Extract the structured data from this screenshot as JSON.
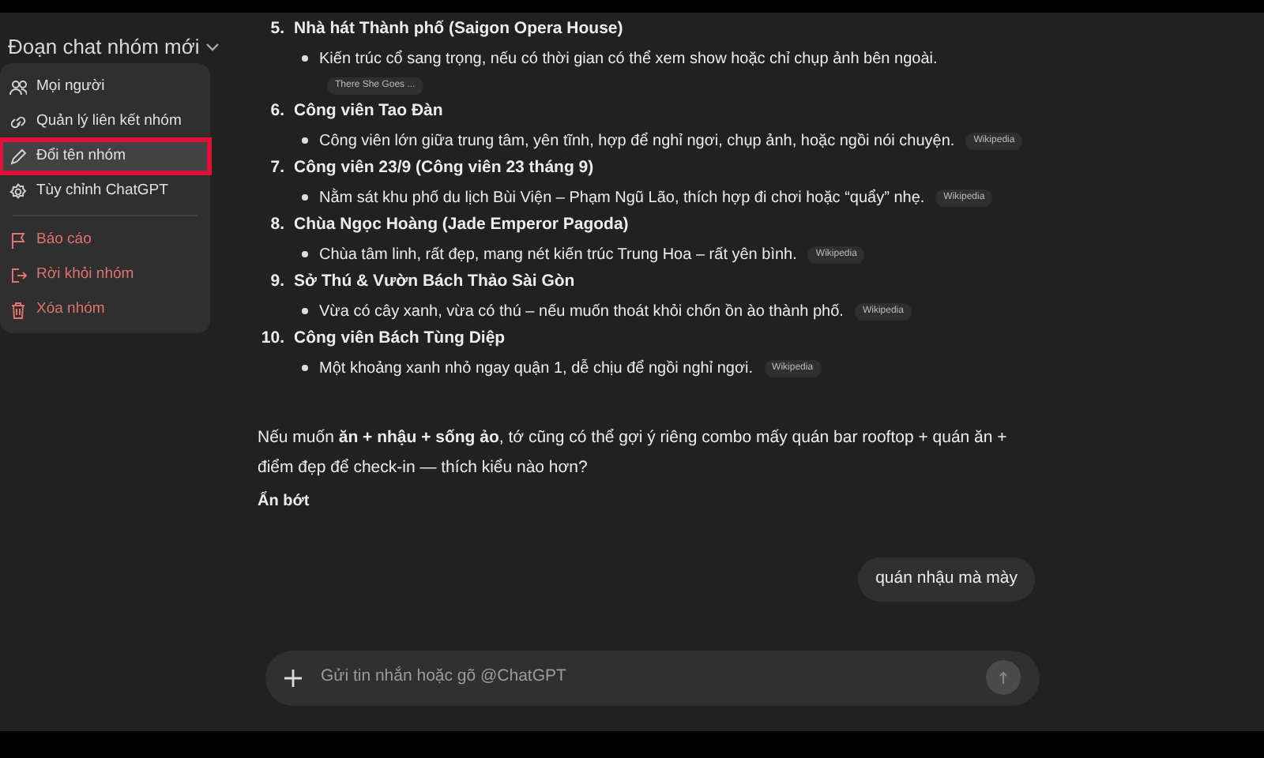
{
  "header": {
    "title": "Đoạn chat nhóm mới"
  },
  "menu": {
    "items": [
      {
        "label": "Mọi người",
        "kind": "people",
        "danger": false,
        "selected": false
      },
      {
        "label": "Quản lý liên kết nhóm",
        "kind": "link",
        "danger": false,
        "selected": false
      },
      {
        "label": "Đổi tên nhóm",
        "kind": "pencil",
        "danger": false,
        "selected": true
      },
      {
        "label": "Tùy chỉnh ChatGPT",
        "kind": "gear",
        "danger": false,
        "selected": false
      },
      {
        "label": "Báo cáo",
        "kind": "flag",
        "danger": true,
        "selected": false
      },
      {
        "label": "Rời khỏi nhóm",
        "kind": "exit",
        "danger": true,
        "selected": false
      },
      {
        "label": "Xóa nhóm",
        "kind": "trash",
        "danger": true,
        "selected": false
      }
    ]
  },
  "list": [
    {
      "number": "5.",
      "title": "Nhà hát Thành phố (Saigon Opera House)",
      "bullet": "Kiến trúc cổ sang trọng, nếu có thời gian có thể xem show hoặc chỉ chụp ảnh bên ngoài.",
      "source": "There She Goes ...",
      "source_below": true
    },
    {
      "number": "6.",
      "title": "Công viên Tao Đàn",
      "bullet": "Công viên lớn giữa trung tâm, yên tĩnh, hợp để nghỉ ngơi, chụp ảnh, hoặc ngồi nói chuyện.",
      "source": "Wikipedia",
      "source_below": false
    },
    {
      "number": "7.",
      "title": "Công viên 23/9 (Công viên 23 tháng 9)",
      "bullet": "Nằm sát khu phố du lịch Bùi Viện – Phạm Ngũ Lão, thích hợp đi chơi hoặc “quẩy” nhẹ.",
      "source": "Wikipedia",
      "source_below": false
    },
    {
      "number": "8.",
      "title": "Chùa Ngọc Hoàng (Jade Emperor Pagoda)",
      "bullet": "Chùa tâm linh, rất đẹp, mang nét kiến trúc Trung Hoa – rất yên bình.",
      "source": "Wikipedia",
      "source_below": false
    },
    {
      "number": "9.",
      "title": "Sở Thú & Vườn Bách Thảo Sài Gòn",
      "bullet": "Vừa có cây xanh, vừa có thú – nếu muốn thoát khỏi chốn ồn ào thành phố.",
      "source": "Wikipedia",
      "source_below": false
    },
    {
      "number": "10.",
      "title": "Công viên Bách Tùng Diệp",
      "bullet": "Một khoảng xanh nhỏ ngay quận 1, dễ chịu để ngồi nghỉ ngơi.",
      "source": "Wikipedia",
      "source_below": false
    }
  ],
  "paragraph": "Nếu muốn **ăn + nhậu + sống ảo**, tớ cũng có thể gợi ý riêng combo mấy quán bar rooftop + quán ăn + điểm đẹp để check-in — thích kiểu nào hơn?",
  "collapse_link": "Ẩn bớt",
  "user_message": "quán nhậu mà mày",
  "composer": {
    "placeholder": "Gửi tin nhắn hoặc gõ @ChatGPT"
  }
}
